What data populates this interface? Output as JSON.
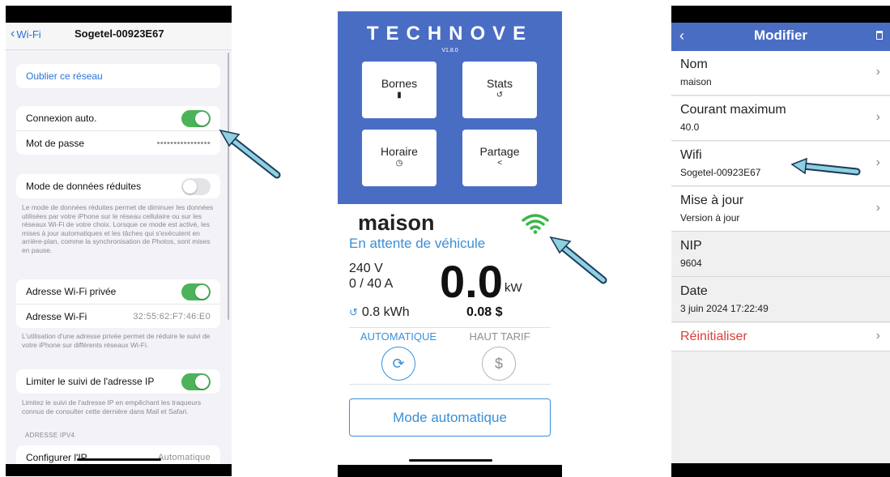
{
  "phone1": {
    "nav": {
      "back_label": "Wi-Fi",
      "title": "Sogetel-00923E67"
    },
    "forget_label": "Oublier ce réseau",
    "auto_join_label": "Connexion auto.",
    "password_label": "Mot de passe",
    "password_value": "••••••••••••••••",
    "low_data_label": "Mode de données réduites",
    "low_data_note": "Le mode de données réduites permet de diminuer les données utilisées par votre iPhone sur le réseau cellulaire ou sur les réseaux Wi-Fi de votre choix. Lorsque ce mode est activé, les mises à jour automatiques et les tâches qui s'exécutent en arrière-plan, comme la synchronisation de Photos, sont mises en pause.",
    "private_addr_label": "Adresse Wi-Fi privée",
    "wifi_addr_label": "Adresse Wi-Fi",
    "wifi_addr_value": "32:55:62:F7:46:E0",
    "private_note": "L'utilisation d'une adresse privée permet de réduire le suivi de votre iPhone sur différents réseaux Wi-Fi.",
    "limit_ip_label": "Limiter le suivi de l'adresse IP",
    "limit_ip_note": "Limitez le suivi de l'adresse IP en empêchant les traqueurs connus de consulter cette dernière dans Mail et Safari.",
    "ipv4_header": "ADRESSE IPV4",
    "configure_ip_label": "Configurer l'IP",
    "configure_ip_value": "Automatique",
    "toggles": {
      "auto_join": true,
      "low_data": false,
      "private_addr": true,
      "limit_ip": true
    }
  },
  "phone2": {
    "logo": "TECHNOVE",
    "version": "V1.8.0",
    "tiles": [
      {
        "label": "Bornes",
        "icon": "charger-icon"
      },
      {
        "label": "Stats",
        "icon": "history-icon"
      },
      {
        "label": "Horaire",
        "icon": "clock-icon"
      },
      {
        "label": "Partage",
        "icon": "share-icon"
      }
    ],
    "station_name": "maison",
    "status": "En attente de véhicule",
    "voltage": "240 V",
    "current": "0 / 40 A",
    "power": "0.0",
    "power_unit": "kW",
    "energy": "0.8 kWh",
    "cost": "0.08 $",
    "mode_auto_label": "AUTOMATIQUE",
    "mode_high_label": "HAUT TARIF",
    "mode_button": "Mode automatique",
    "colors": {
      "header": "#4a6dc4",
      "accent": "#3a8fd8",
      "wifi": "#3bb54a"
    }
  },
  "phone3": {
    "title": "Modifier",
    "rows": [
      {
        "label": "Nom",
        "value": "maison"
      },
      {
        "label": "Courant maximum",
        "value": "40.0"
      },
      {
        "label": "Wifi",
        "value": "Sogetel-00923E67"
      },
      {
        "label": "Mise à jour",
        "value": "Version à jour"
      },
      {
        "label": "NIP",
        "value": "9604"
      },
      {
        "label": "Date",
        "value": "3 juin 2024 17:22:49"
      }
    ],
    "reset_label": "Réinitialiser",
    "colors": {
      "bar": "#4a6dc4",
      "reset": "#d9403a"
    }
  }
}
